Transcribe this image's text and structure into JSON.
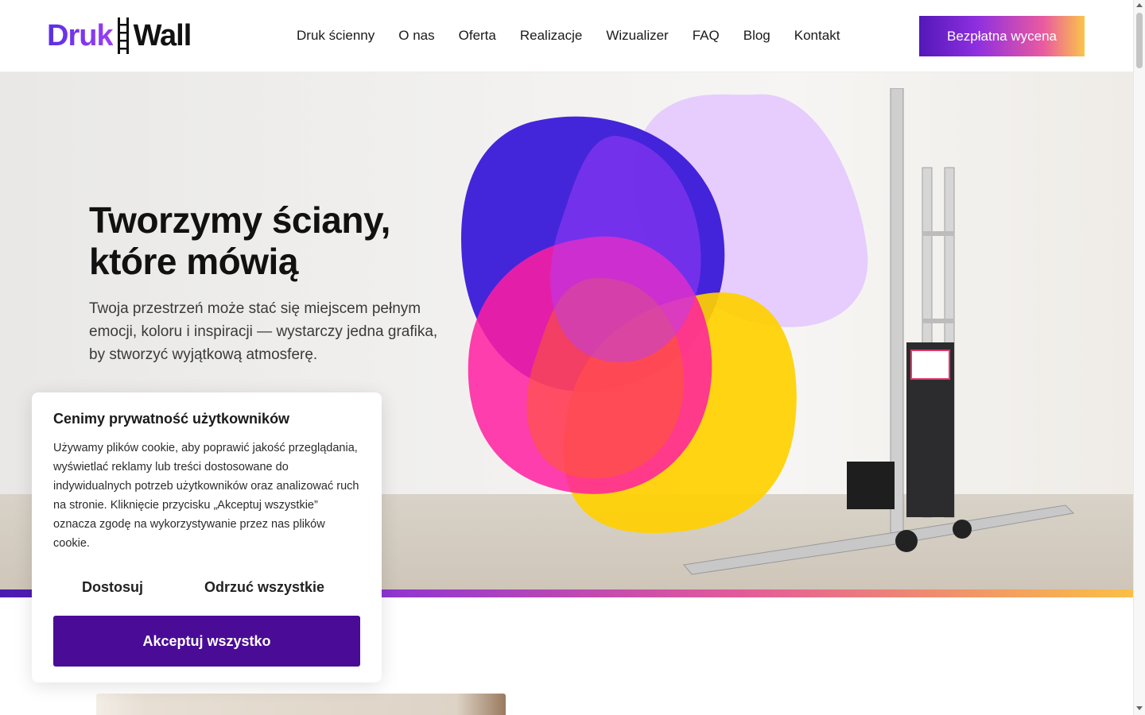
{
  "header": {
    "logo_part1": "Druk",
    "logo_part2": "Wall",
    "nav": [
      {
        "label": "Druk ścienny"
      },
      {
        "label": "O nas"
      },
      {
        "label": "Oferta"
      },
      {
        "label": "Realizacje"
      },
      {
        "label": "Wizualizer"
      },
      {
        "label": "FAQ"
      },
      {
        "label": "Blog"
      },
      {
        "label": "Kontakt"
      }
    ],
    "cta_label": "Bezpłatna wycena"
  },
  "hero": {
    "title_line1": "Tworzymy ściany,",
    "title_line2": "które mówią",
    "text": "Twoja przestrzeń może stać się miejscem pełnym emocji, koloru i inspiracji — wystarczy jedna grafika, by stworzyć wyjątkową atmosferę."
  },
  "cookie": {
    "title": "Cenimy prywatność użytkowników",
    "text": "Używamy plików cookie, aby poprawić jakość przeglądania, wyświetlać reklamy lub treści dostosowane do indywidualnych potrzeb użytkowników oraz analizować ruch na stronie. Kliknięcie przycisku „Akceptuj wszystkie” oznacza zgodę na wykorzystywanie przez nas plików cookie.",
    "customize_label": "Dostosuj",
    "reject_label": "Odrzuć wszystkie",
    "accept_label": "Akceptuj wszystko"
  },
  "colors": {
    "brand_purple": "#4a0c96",
    "cta_gradient_start": "#5318b8",
    "cta_gradient_end": "#fbc44a"
  }
}
